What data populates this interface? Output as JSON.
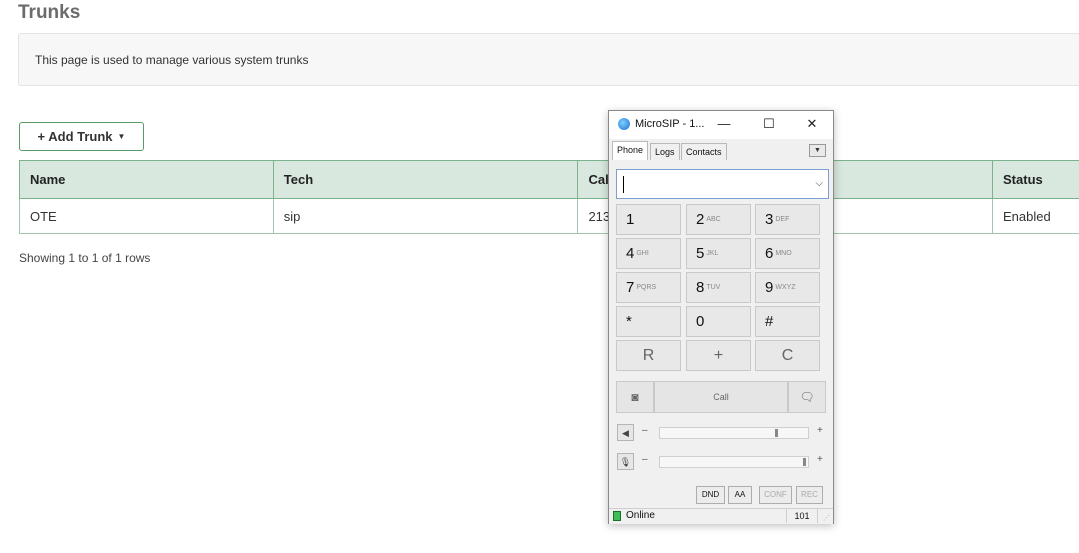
{
  "page": {
    "title": "Trunks",
    "description": "This page is used to manage various system trunks",
    "add_button": "+ Add Trunk",
    "showing": "Showing 1 to 1 of 1 rows"
  },
  "table": {
    "headers": [
      "Name",
      "Tech",
      "Cal",
      "Status"
    ],
    "rows": [
      {
        "name": "OTE",
        "tech": "sip",
        "callerid": "213",
        "status": "Enabled"
      }
    ]
  },
  "microsip": {
    "title": "MicroSIP - 1...",
    "tabs": [
      "Phone",
      "Logs",
      "Contacts"
    ],
    "keypad": [
      {
        "digit": "1",
        "letters": ""
      },
      {
        "digit": "2",
        "letters": "ABC"
      },
      {
        "digit": "3",
        "letters": "DEF"
      },
      {
        "digit": "4",
        "letters": "GHI"
      },
      {
        "digit": "5",
        "letters": "JKL"
      },
      {
        "digit": "6",
        "letters": "MNO"
      },
      {
        "digit": "7",
        "letters": "PQRS"
      },
      {
        "digit": "8",
        "letters": "TUV"
      },
      {
        "digit": "9",
        "letters": "WXYZ"
      },
      {
        "digit": "*",
        "letters": ""
      },
      {
        "digit": "0",
        "letters": ""
      },
      {
        "digit": "#",
        "letters": ""
      }
    ],
    "controls": [
      "R",
      "+",
      "C"
    ],
    "call_label": "Call",
    "buttons": [
      "DND",
      "AA",
      "CONF",
      "REC"
    ],
    "status": "Online",
    "extension": "101"
  }
}
